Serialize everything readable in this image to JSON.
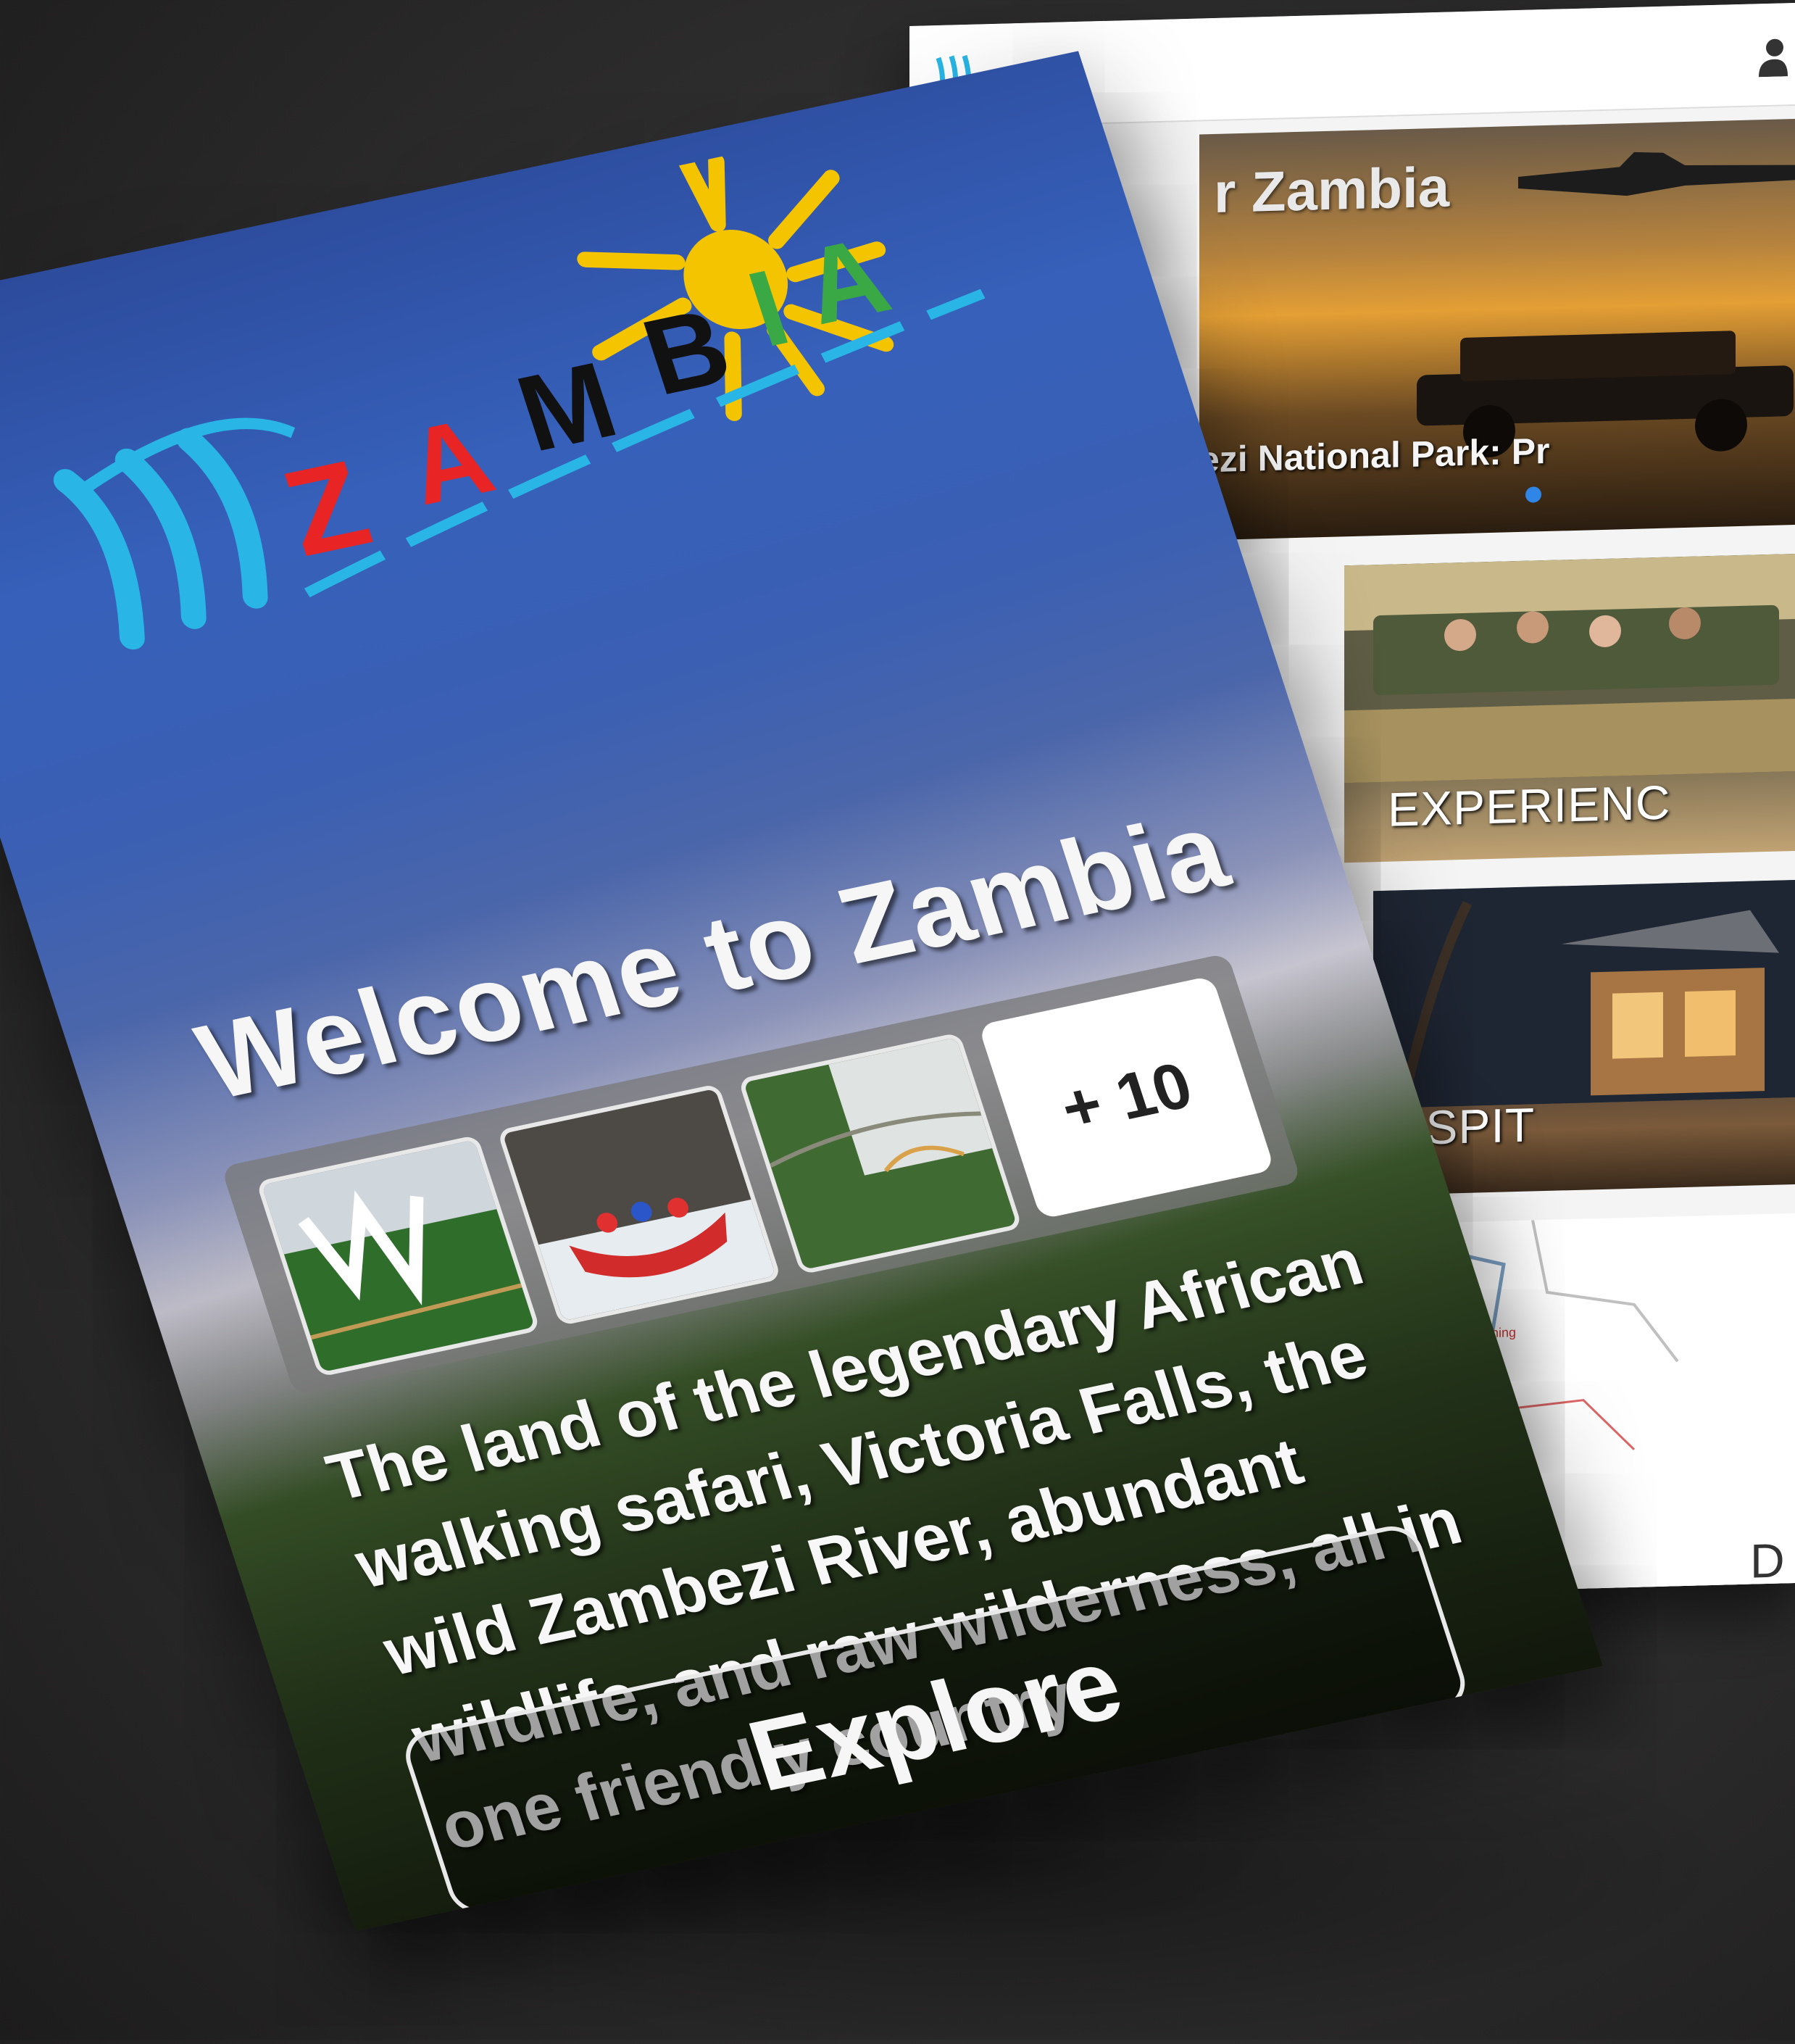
{
  "welcome": {
    "logo_text": "ZAMBIA",
    "title": "Welcome to Zambia",
    "gallery": {
      "thumbnails": [
        {
          "name": "victoria-falls"
        },
        {
          "name": "rafting"
        },
        {
          "name": "gorge-bridge"
        }
      ],
      "more_label": "+ 10"
    },
    "description": "The land of the legendary African walking safari, Victoria Falls, the wild Zambezi River, abundant wildlife, and raw wilderness, all in one friendly country",
    "explore_label": "Explore"
  },
  "home": {
    "hero": {
      "title": "r Zambia",
      "subtitle": "ezi National Park: Pr"
    },
    "experience_label": "EXPERIENC",
    "hospitality_label": "OSPIT",
    "map_label": "D",
    "map_town": "Ching"
  },
  "colors": {
    "zambia_red": "#e82424",
    "zambia_black": "#111111",
    "zambia_green": "#3aa845",
    "sun_yellow": "#f5c400",
    "water_cyan": "#29b6e6",
    "dot_blue": "#2f86e6"
  },
  "icons": {
    "profile": "profile-icon",
    "logo": "zambia-falls-logo"
  }
}
